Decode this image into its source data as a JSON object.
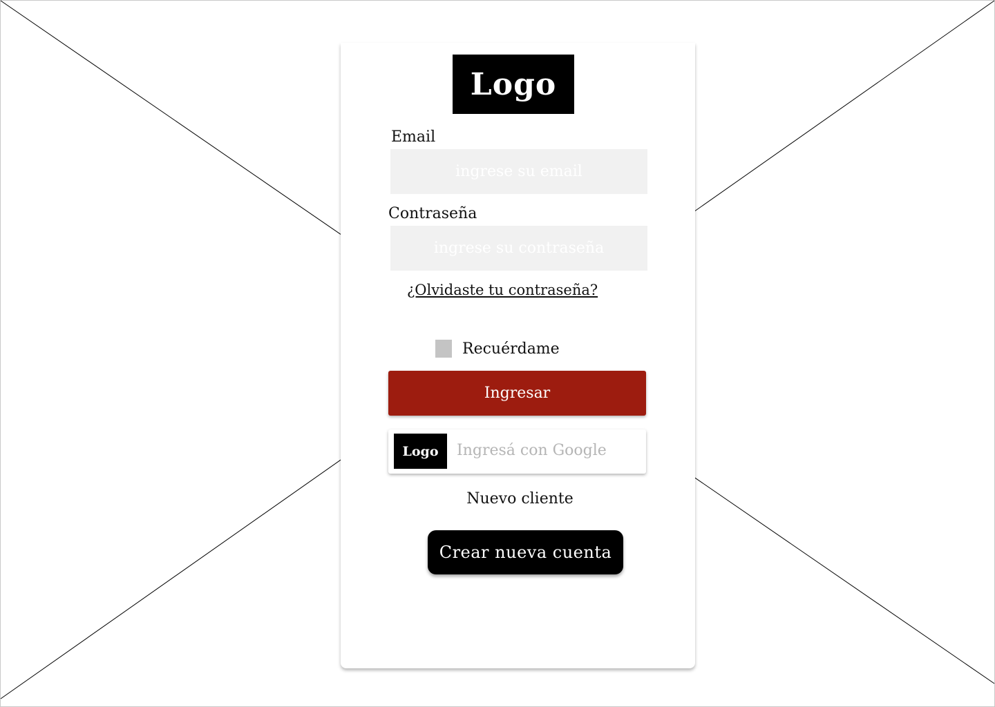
{
  "logo": {
    "text": "Logo"
  },
  "form": {
    "email_label": "Email",
    "email_placeholder": "ingrese su email",
    "password_label": "Contraseña",
    "password_placeholder": "ingrese su contraseña",
    "forgot_link": "¿Olvidaste tu contraseña?",
    "remember_label": "Recuérdame",
    "login_button": "Ingresar"
  },
  "google_login": {
    "logo_text": "Logo",
    "label": "Ingresá con Google"
  },
  "signup": {
    "prompt": "Nuevo cliente",
    "button": "Crear nueva cuenta"
  },
  "colors": {
    "primary_button": "#9d1c0f",
    "input_background": "#f1f1f1",
    "checkbox": "#c4c4c4",
    "logo_background": "#000000"
  }
}
